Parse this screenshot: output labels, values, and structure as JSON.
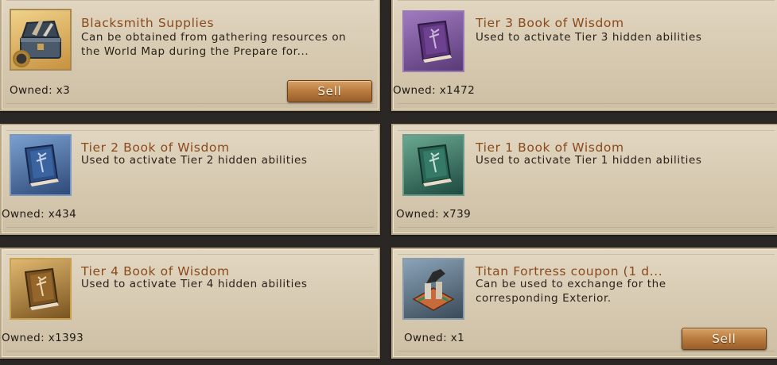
{
  "sell_label": "Sell",
  "items": [
    {
      "title": "Blacksmith Supplies",
      "description": "Can be obtained from gathering resources on the World Map during the Prepare for...",
      "owned": "Owned: x3",
      "icon": "blacksmith-chest-icon",
      "has_sell": true
    },
    {
      "title": "Tier 3 Book of Wisdom",
      "description": "Used to activate Tier 3 hidden abilities",
      "owned": "Owned: x1472",
      "icon": "purple-book-icon",
      "has_sell": false
    },
    {
      "title": "Tier 2 Book of Wisdom",
      "description": "Used to activate Tier 2 hidden abilities",
      "owned": "Owned: x434",
      "icon": "blue-book-icon",
      "has_sell": false
    },
    {
      "title": "Tier 1 Book of Wisdom",
      "description": "Used to activate Tier 1 hidden abilities",
      "owned": "Owned: x739",
      "icon": "green-book-icon",
      "has_sell": false
    },
    {
      "title": "Tier 4 Book of Wisdom",
      "description": "Used to activate Tier 4 hidden abilities",
      "owned": "Owned: x1393",
      "icon": "gold-book-icon",
      "has_sell": false
    },
    {
      "title": "Titan Fortress coupon (1 d...",
      "description": "Can be used to exchange for the corresponding Exterior.",
      "owned": "Owned: x1",
      "icon": "fortress-coupon-icon",
      "has_sell": true
    }
  ],
  "colors": {
    "tier3": "#6a3f8a",
    "tier2": "#3a5c8e",
    "tier1": "#3a7060",
    "tier4": "#8a6428",
    "title_text": "#8a4a1c",
    "sell_button": "#b87a3e"
  }
}
